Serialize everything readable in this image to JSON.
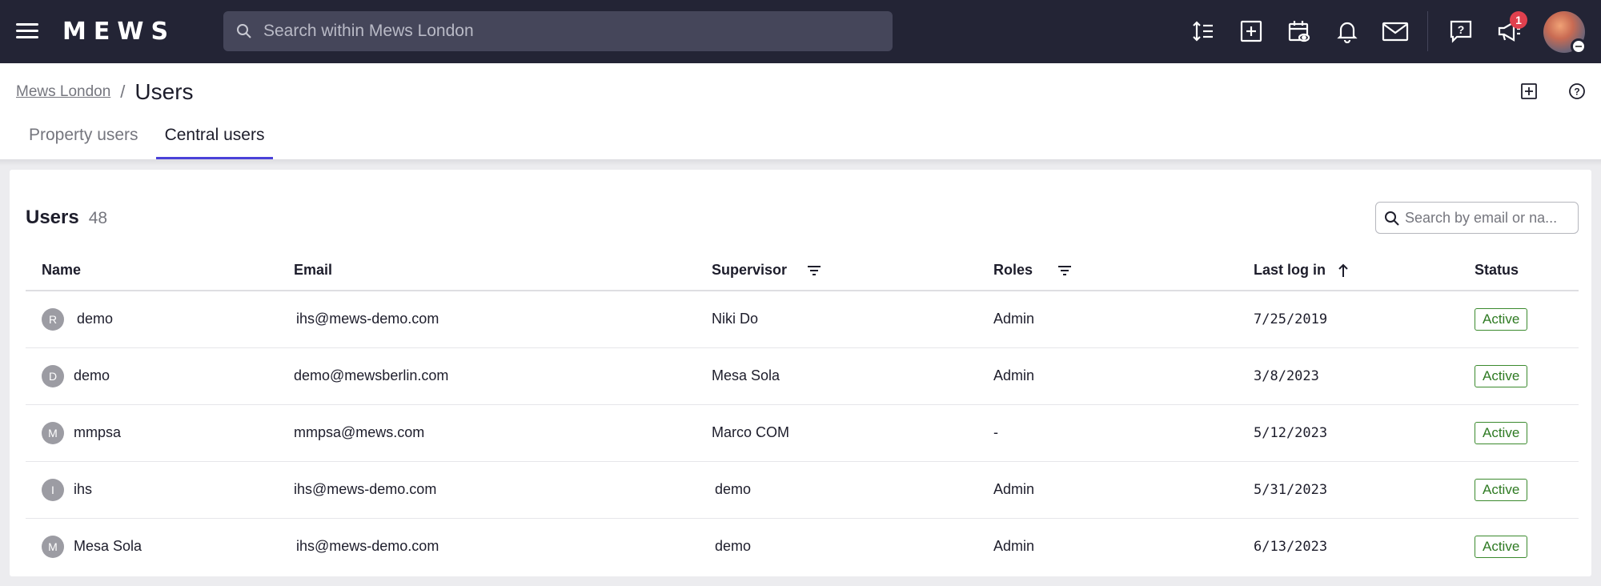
{
  "app": {
    "logo_text": "MEWS",
    "search_placeholder": "Search within Mews London",
    "notification_count": "1"
  },
  "breadcrumb": {
    "parent": "Mews London",
    "separator": "/",
    "current": "Users"
  },
  "tabs": [
    {
      "label": "Property users",
      "active": false
    },
    {
      "label": "Central users",
      "active": true
    }
  ],
  "users_card": {
    "title": "Users",
    "count": "48",
    "search_placeholder": "Search by email or na..."
  },
  "table": {
    "columns": [
      "Name",
      "Email",
      "Supervisor",
      "Roles",
      "Last log in",
      "Status"
    ],
    "rows": [
      {
        "initial": "R",
        "name": "demo",
        "email": "ihs@mews-demo.com",
        "supervisor": "Niki Do",
        "roles": "Admin",
        "last_login": "7/25/2019",
        "status": "Active"
      },
      {
        "initial": "D",
        "name": "demo",
        "email": "demo@mewsberlin.com",
        "supervisor": "Mesa Sola",
        "roles": "Admin",
        "last_login": "3/8/2023",
        "status": "Active"
      },
      {
        "initial": "M",
        "name": "mmpsa",
        "email": "mmpsa@mews.com",
        "supervisor": "Marco COM",
        "roles": "-",
        "last_login": "5/12/2023",
        "status": "Active"
      },
      {
        "initial": "I",
        "name": "ihs",
        "email": "ihs@mews-demo.com",
        "supervisor": "demo",
        "roles": "Admin",
        "last_login": "5/31/2023",
        "status": "Active"
      },
      {
        "initial": "M",
        "name": "Mesa Sola",
        "email": "ihs@mews-demo.com",
        "supervisor": "demo",
        "roles": "Admin",
        "last_login": "6/13/2023",
        "status": "Active"
      }
    ]
  },
  "colors": {
    "topbar_bg": "#232435",
    "accent": "#4a41d8",
    "status_active": "#2e7a22",
    "badge": "#e0404e"
  },
  "icons": [
    "menu-icon",
    "search-icon",
    "line-height-icon",
    "add-box-icon",
    "calendar-view-icon",
    "bell-icon",
    "mail-icon",
    "help-chat-icon",
    "megaphone-icon",
    "add-box-icon",
    "help-circle-icon",
    "filter-icon",
    "sort-ascending-icon"
  ]
}
